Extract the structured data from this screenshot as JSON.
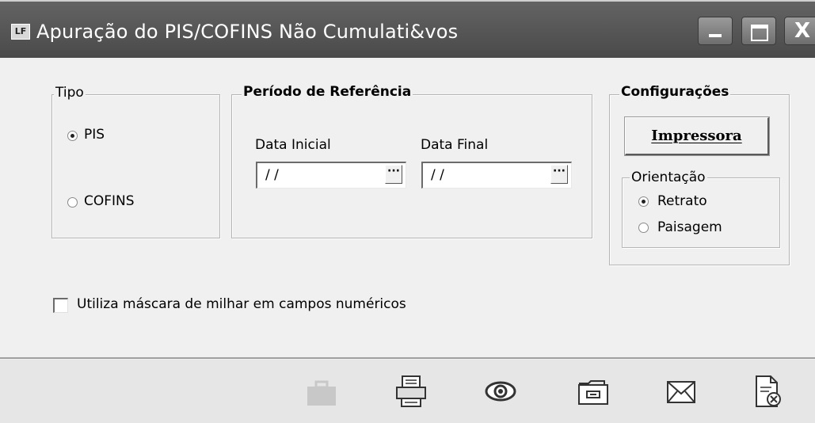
{
  "window": {
    "title": "Apuração do PIS/COFINS Não Cumulati&vos",
    "app_icon_text": "LF"
  },
  "tipo": {
    "legend": "Tipo",
    "options": [
      {
        "label": "PIS",
        "checked": true
      },
      {
        "label": "COFINS",
        "checked": false
      }
    ]
  },
  "periodo": {
    "legend": "Período de Referência",
    "data_inicial_label": "Data Inicial",
    "data_inicial_value": "/ /",
    "data_final_label": "Data Final",
    "data_final_value": "/ /",
    "picker_label": "···"
  },
  "configuracoes": {
    "legend": "Configurações",
    "printer_button": "Impressora",
    "orientacao": {
      "legend": "Orientação",
      "options": [
        {
          "label": "Retrato",
          "checked": true
        },
        {
          "label": "Paisagem",
          "checked": false
        }
      ]
    }
  },
  "mask_checkbox": {
    "label": "Utiliza máscara de milhar em campos numéricos",
    "checked": false
  },
  "toolbar": {
    "icons": [
      "briefcase-icon",
      "printer-icon",
      "eye-icon",
      "folder-icon",
      "envelope-icon",
      "close-document-icon"
    ]
  }
}
